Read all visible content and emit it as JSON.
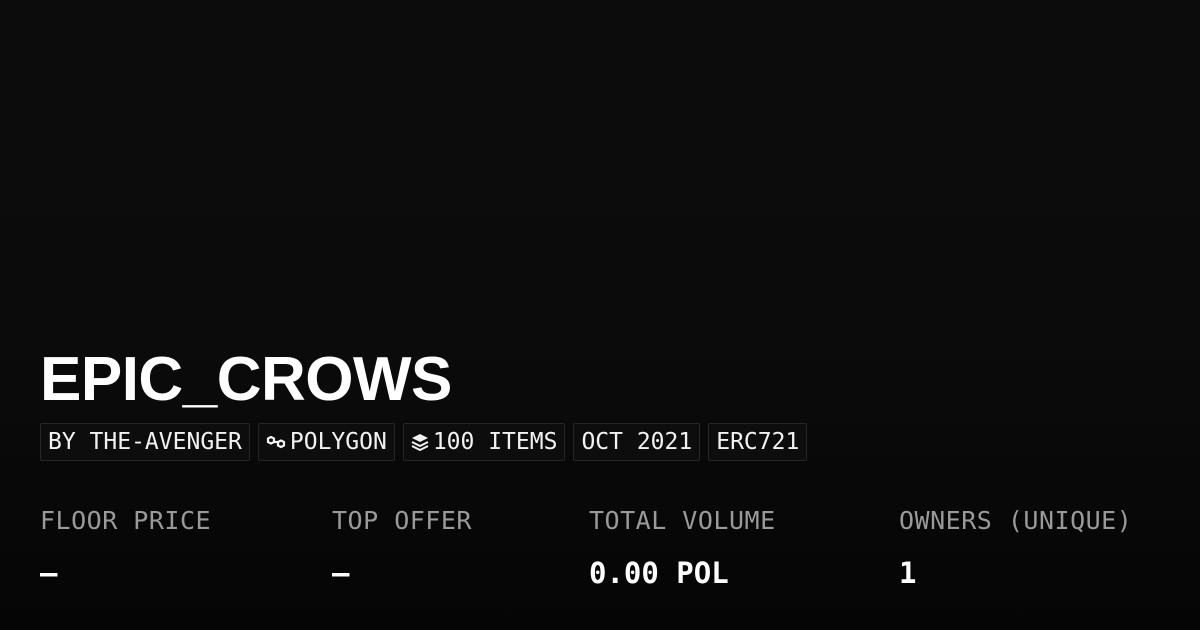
{
  "collection": {
    "name": "EPIC_CROWS"
  },
  "tags": {
    "creator": "BY THE-AVENGER",
    "chain": "POLYGON",
    "items": "100 ITEMS",
    "date": "OCT 2021",
    "standard": "ERC721"
  },
  "icons": {
    "chain": "polygon-link-icon",
    "items": "layers-icon"
  },
  "stats": [
    {
      "label": "FLOOR PRICE",
      "value": "–"
    },
    {
      "label": "TOP OFFER",
      "value": "–"
    },
    {
      "label": "TOTAL VOLUME",
      "value": "0.00 POL"
    },
    {
      "label": "OWNERS (UNIQUE)",
      "value": "1"
    }
  ],
  "colors": {
    "background": "#0b0b0b",
    "label": "#9a9a9a",
    "text": "#ffffff",
    "tag_border": "#262626"
  }
}
